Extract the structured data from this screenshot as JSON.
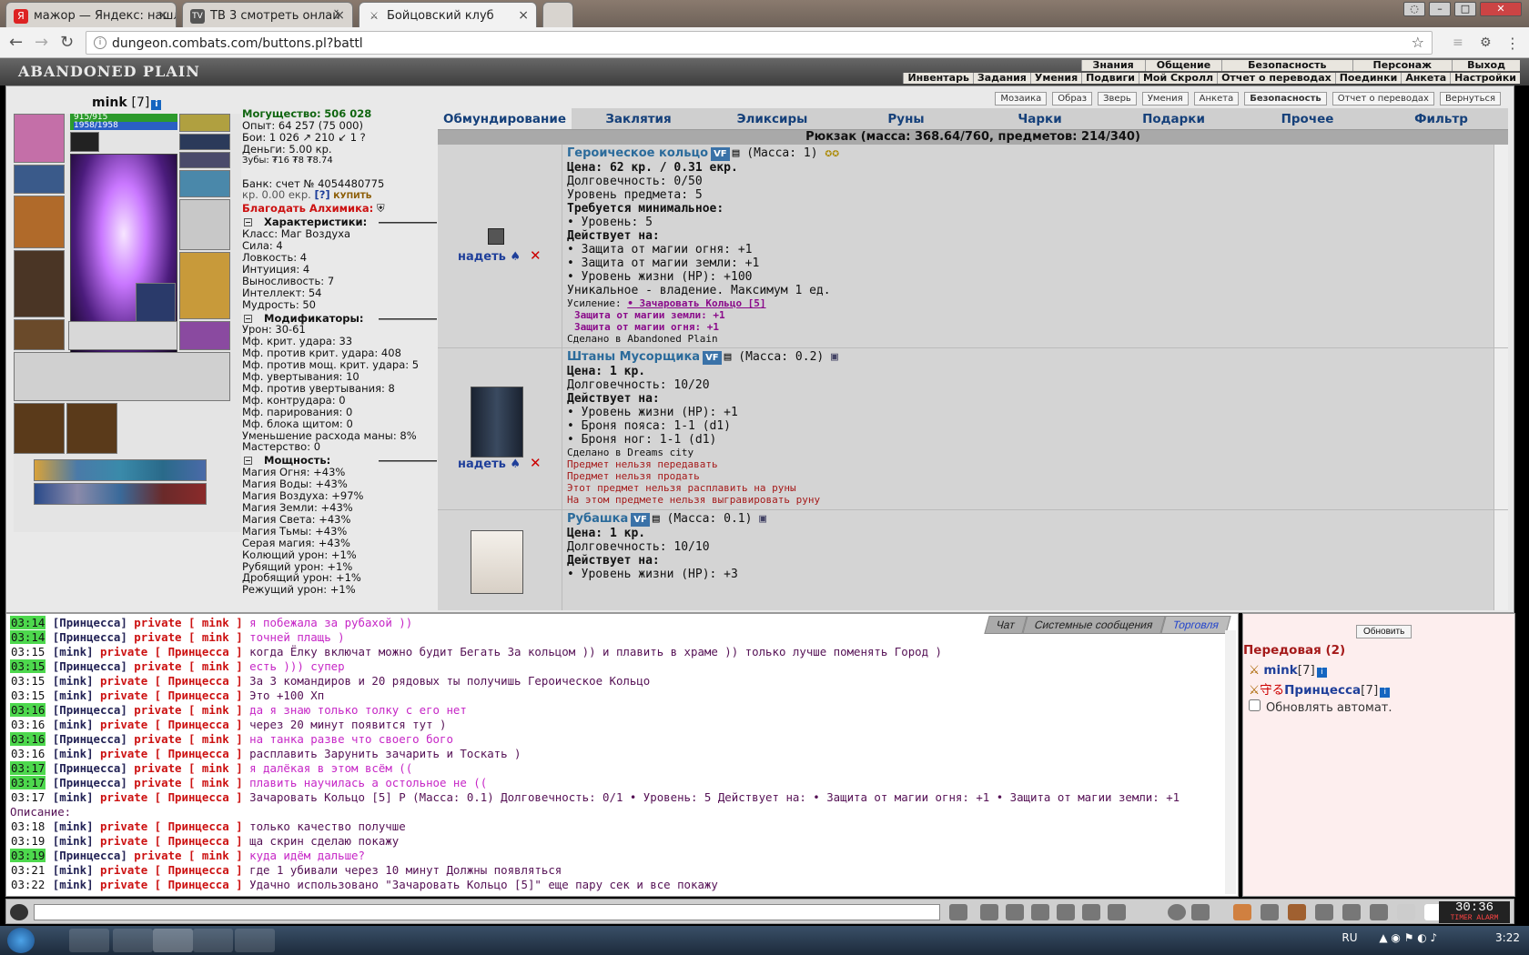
{
  "browser": {
    "tabs": [
      {
        "label": "мажор — Яндекс: нашл",
        "icon": "Я"
      },
      {
        "label": "ТВ 3 смотреть онлай",
        "icon": "TV"
      },
      {
        "label": "Бойцовский клуб",
        "icon": "⚔"
      }
    ],
    "url": "dungeon.combats.com/buttons.pl?battl"
  },
  "game": {
    "logo": "ABANDONED PLAIN",
    "menu_top": [
      "Знания",
      "Общение",
      "Безопасность",
      "Персонаж",
      "Выход"
    ],
    "menu_bottom": [
      "Инвентарь",
      "Задания",
      "Умения",
      "Подвиги",
      "Мой Скролл",
      "Отчет о переводах",
      "Поединки",
      "Анкета",
      "Настройки"
    ]
  },
  "character": {
    "name": "mink",
    "level": "[7]",
    "hp": "915/915",
    "mp": "1958/1958"
  },
  "stats": {
    "power_label": "Могущество:",
    "power": "506 028",
    "exp": "Опыт: 64 257 (75 000)",
    "fights": "Бои:  1 026 ↗  210 ↙  1 ?",
    "money": "Деньги: 5.00 кр.",
    "teeth": "Зубы: ₮16 ₮8 ₮8.74",
    "bank": "Банк: счет № 4054480775",
    "ekr": "кр. 0.00 екр.",
    "help": "[?]",
    "buy": "КУПИТЬ",
    "bless": "Благодать Алхимика:",
    "char_header": "Характеристики:",
    "chars": [
      "Класс: Маг Воздуха",
      "Сила: 4",
      "Ловкость: 4",
      "Интуиция: 4",
      "Выносливость: 7",
      "Интеллект: 54",
      "Мудрость: 50"
    ],
    "mod_header": "Модификаторы:",
    "mods": [
      "Урон: 30-61",
      "Мф. крит. удара: 33",
      "Мф. против крит. удара: 408",
      "Мф. против мощ. крит. удара: 5",
      "Мф. увертывания: 10",
      "Мф. против увертывания: 8",
      "Мф. контрудара: 0",
      "Мф. парирования: 0",
      "Мф. блока щитом: 0",
      "Уменьшение расхода маны: 8%",
      "Мастерство: 0"
    ],
    "pow_header": "Мощность:",
    "powers": [
      "Магия Огня: +43%",
      "Магия Воды: +43%",
      "Магия Воздуха: +97%",
      "Магия Земли: +43%",
      "Магия Света: +43%",
      "Магия Тьмы: +43%",
      "Серая магия: +43%",
      "Колющий урон: +1%",
      "Рубящий урон: +1%",
      "Дробящий урон: +1%",
      "Режущий урон: +1%"
    ]
  },
  "subnav": [
    "Мозаика",
    "Образ",
    "Зверь",
    "Умения",
    "Анкета",
    "Безопасность",
    "Отчет о переводах",
    "Вернуться"
  ],
  "inv": {
    "tabs": [
      "Обмундирование",
      "Заклятия",
      "Эликсиры",
      "Руны",
      "Чарки",
      "Подарки",
      "Прочее",
      "Фильтр"
    ],
    "backpack": "Рюкзак (масса: 368.64/760, предметов: 214/340)",
    "put": "надеть",
    "del": "✕",
    "items": [
      {
        "name": "Героическое кольцо",
        "vf": "VF",
        "mass": "(Масса: 1)",
        "lines": [
          "Цена: 62 кр. / 0.31 екр.",
          "Долговечность: 0/50",
          "Уровень предмета: 5",
          "Требуется минимальное:",
          "• Уровень: 5",
          "Действует на:",
          "• Защита от магии огня: +1",
          "• Защита от магии земли: +1",
          "• Уровень жизни (HP): +100",
          "Уникальное - владение. Максимум 1 ед."
        ],
        "enh_label": "Усиление:",
        "enh_link": "• Зачаровать Кольцо [5]",
        "enh_lines": [
          "Защита от магии земли: +1",
          "Защита от магии огня: +1"
        ],
        "made": "Сделано в Abandoned Plain"
      },
      {
        "name": "Штаны Мусорщика",
        "vf": "VF",
        "mass": "(Масса: 0.2)",
        "lines": [
          "Цена: 1 кр.",
          "Долговечность: 10/20",
          "Действует на:",
          "• Уровень жизни (HP): +1",
          "• Броня пояса: 1-1 (d1)",
          "• Броня ног: 1-1 (d1)"
        ],
        "made": "Сделано в Dreams city",
        "warns": [
          "Предмет нельзя передавать",
          "Предмет нельзя продать",
          "Этот предмет нельзя расплавить на руны",
          "На этом предмете нельзя выгравировать руну"
        ]
      },
      {
        "name": "Рубашка",
        "vf": "VF",
        "mass": "(Масса: 0.1)",
        "lines": [
          "Цена: 1 кр.",
          "Долговечность: 10/10",
          "Действует на:",
          "• Уровень жизни (HP): +3"
        ]
      }
    ]
  },
  "chat": {
    "tabs": [
      "Чат",
      "Системные сообщения",
      "Торговля"
    ],
    "messages": [
      {
        "t": "03:14",
        "hl": true,
        "from": "[Принцесса]",
        "to": "private [ mink ]",
        "msg": "я побежала за рубахой ))",
        "me": false
      },
      {
        "t": "03:14",
        "hl": true,
        "from": "[Принцесса]",
        "to": "private [ mink ]",
        "msg": "точней плащь )",
        "me": false
      },
      {
        "t": "03:15",
        "hl": false,
        "from": "[mink]",
        "to": "private [ Принцесса ]",
        "msg": "когда Ёлку включат можно будит Бегать За кольцом )) и плавить в храме )) только лучше поменять Город )",
        "me": true
      },
      {
        "t": "03:15",
        "hl": true,
        "from": "[Принцесса]",
        "to": "private [ mink ]",
        "msg": "есть ))) супер",
        "me": false
      },
      {
        "t": "03:15",
        "hl": false,
        "from": "[mink]",
        "to": "private [ Принцесса ]",
        "msg": "За 3 командиров и 20 рядовых ты получишь Героическое Кольцо",
        "me": true
      },
      {
        "t": "03:15",
        "hl": false,
        "from": "[mink]",
        "to": "private [ Принцесса ]",
        "msg": "Это +100 Хп",
        "me": true
      },
      {
        "t": "03:16",
        "hl": true,
        "from": "[Принцесса]",
        "to": "private [ mink ]",
        "msg": "да я знаю только толку с его нет",
        "me": false
      },
      {
        "t": "03:16",
        "hl": false,
        "from": "[mink]",
        "to": "private [ Принцесса ]",
        "msg": "через 20 минут появится тут )",
        "me": true
      },
      {
        "t": "03:16",
        "hl": true,
        "from": "[Принцесса]",
        "to": "private [ mink ]",
        "msg": "на танка разве что своего бого",
        "me": false
      },
      {
        "t": "03:16",
        "hl": false,
        "from": "[mink]",
        "to": "private [ Принцесса ]",
        "msg": "расплавить Зарунить зачарить и Тоскать )",
        "me": true
      },
      {
        "t": "03:17",
        "hl": true,
        "from": "[Принцесса]",
        "to": "private [ mink ]",
        "msg": "я далёкая в этом всём ((",
        "me": false
      },
      {
        "t": "03:17",
        "hl": true,
        "from": "[Принцесса]",
        "to": "private [ mink ]",
        "msg": "плавить научилась а остольное не ((",
        "me": false
      },
      {
        "t": "03:17",
        "hl": false,
        "from": "[mink]",
        "to": "private [ Принцесса ]",
        "msg": "Зачаровать Кольцо [5] Р (Масса: 0.1) Долговечность: 0/1 • Уровень: 5 Действует на: • Защита от магии огня: +1 • Защита от магии земли: +1",
        "me": true
      }
    ],
    "desc_label": "Описание:",
    "messages2": [
      {
        "t": "03:18",
        "hl": false,
        "from": "[mink]",
        "to": "private [ Принцесса ]",
        "msg": "только качество получше",
        "me": true
      },
      {
        "t": "03:19",
        "hl": false,
        "from": "[mink]",
        "to": "private [ Принцесса ]",
        "msg": "ща скрин сделаю покажу",
        "me": true
      },
      {
        "t": "03:19",
        "hl": true,
        "from": "[Принцесса]",
        "to": "private [ mink ]",
        "msg": "куда идём дальше?",
        "me": false
      },
      {
        "t": "03:21",
        "hl": false,
        "from": "[mink]",
        "to": "private [ Принцесса ]",
        "msg": "где 1 убивали через 10 минут Должны появляться",
        "me": true
      },
      {
        "t": "03:22",
        "hl": false,
        "from": "[mink]",
        "to": "private [ Принцесса ]",
        "msg": "Удачно использовано \"Зачаровать Кольцо [5]\" еще пару сек и все покажу",
        "me": true
      }
    ]
  },
  "right": {
    "refresh": "Обновить",
    "front": "Передовая (2)",
    "players": [
      {
        "name": "mink",
        "lvl": "[7]"
      },
      {
        "name": "Принцесса",
        "lvl": "[7]"
      }
    ],
    "auto": "Обновлять автомат."
  },
  "clock": {
    "time": "30:36",
    "sub": "TIMER ALARM"
  },
  "tray": {
    "lang": "RU",
    "time": "3:22"
  }
}
